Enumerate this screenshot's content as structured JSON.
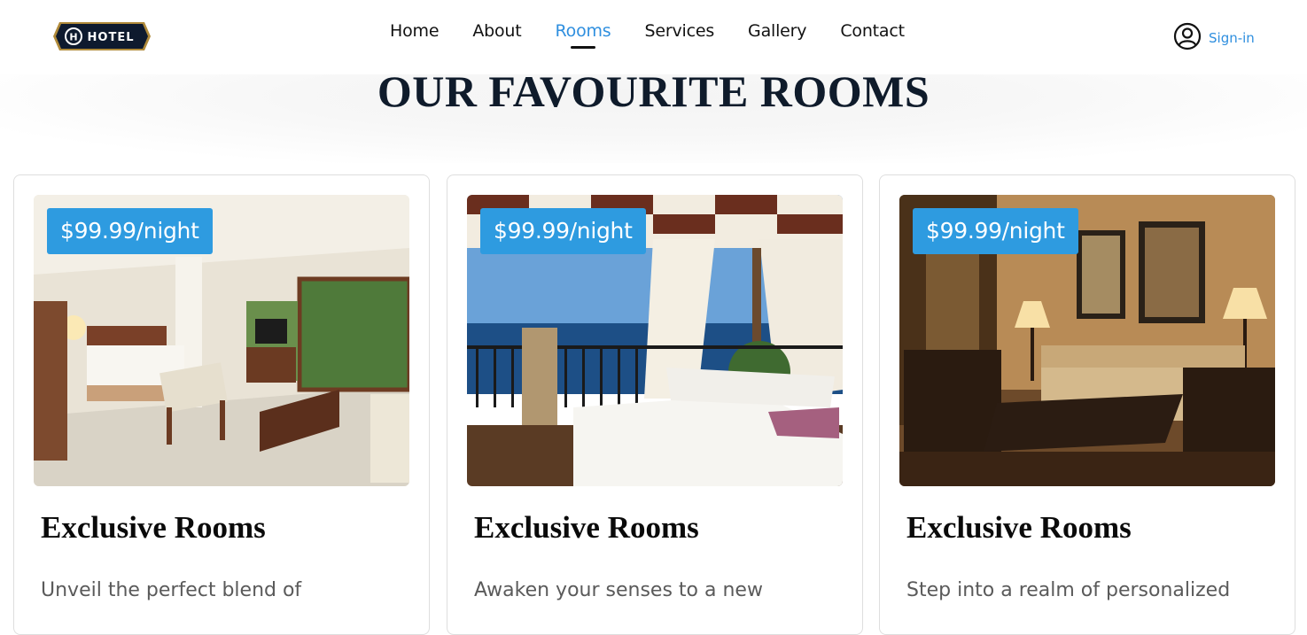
{
  "header": {
    "logo_text": "HOTEL",
    "nav": [
      {
        "label": "Home"
      },
      {
        "label": "About"
      },
      {
        "label": "Rooms"
      },
      {
        "label": "Services"
      },
      {
        "label": "Gallery"
      },
      {
        "label": "Contact"
      }
    ],
    "active_nav": "Rooms",
    "signin_label": "Sign-in"
  },
  "section": {
    "title": "OUR FAVOURITE ROOMS"
  },
  "cards": [
    {
      "price": "$99.99/night",
      "title": "Exclusive Rooms",
      "description": "Unveil the perfect blend of",
      "image": "bright-suite-with-bed-and-balcony"
    },
    {
      "price": "$99.99/night",
      "title": "Exclusive Rooms",
      "description": "Awaken your senses to a new",
      "image": "seaside-terrace-with-massage-beds"
    },
    {
      "price": "$99.99/night",
      "title": "Exclusive Rooms",
      "description": "Step into a realm of personalized",
      "image": "warm-lounge-with-lamps-and-sofa"
    }
  ],
  "colors": {
    "accent": "#2e9be0",
    "nav_active": "#2f8fdf",
    "title": "#0f1b2b"
  }
}
